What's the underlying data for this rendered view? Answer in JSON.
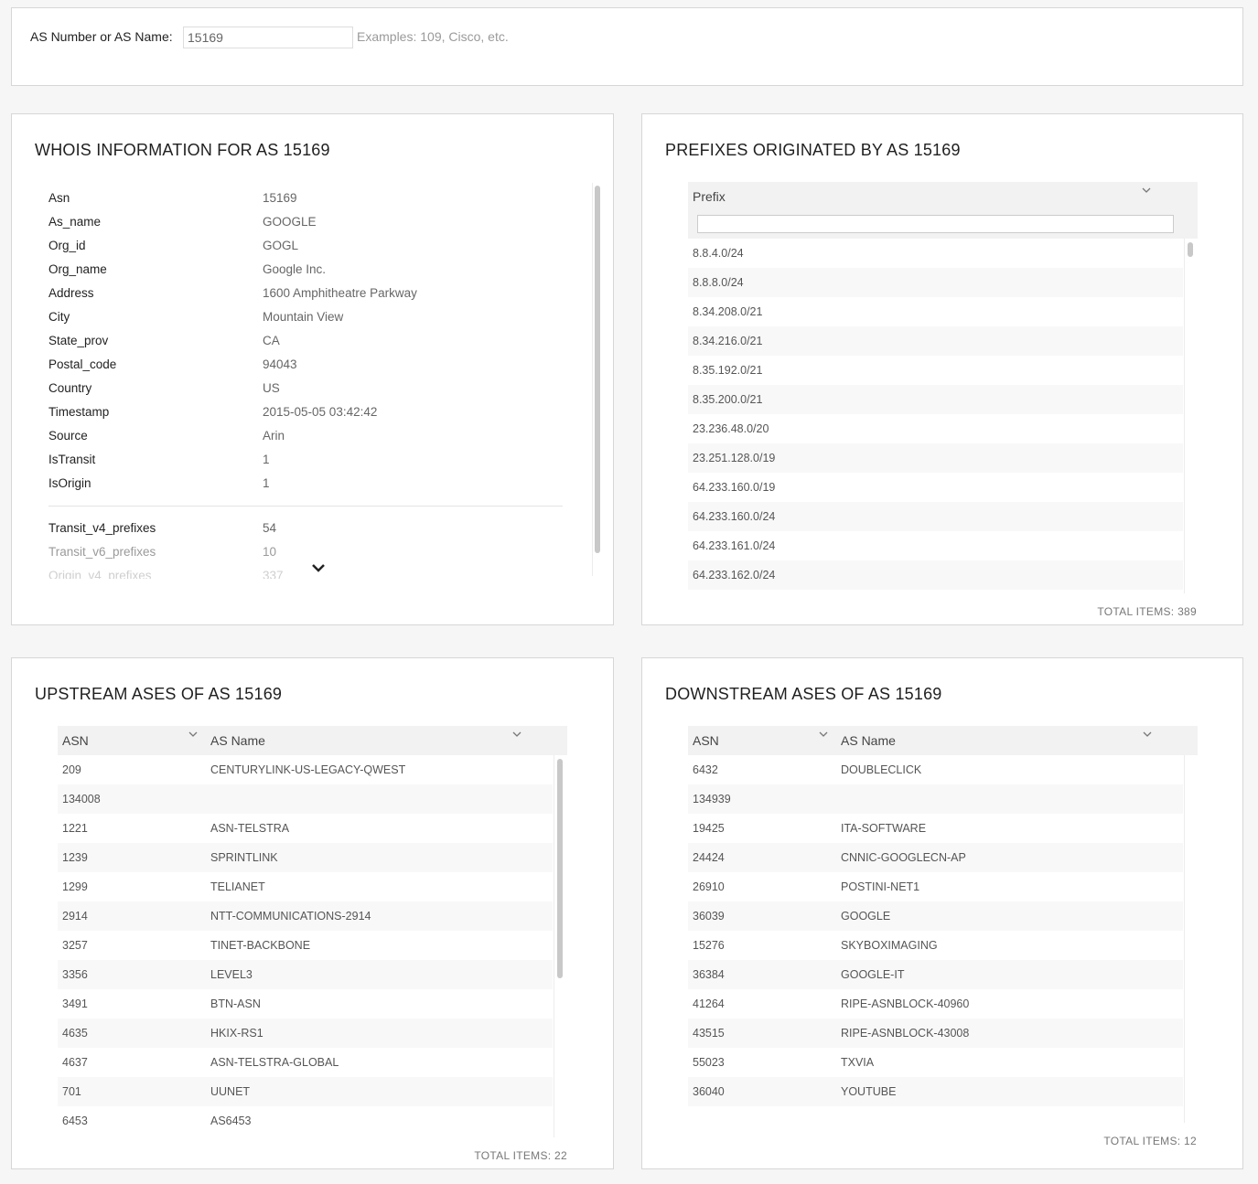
{
  "search": {
    "label": "AS Number or AS Name:",
    "value": "15169",
    "hint": "Examples: 109, Cisco, etc."
  },
  "whois": {
    "title": "WHOIS INFORMATION FOR AS 15169",
    "rows": [
      {
        "key": "Asn",
        "value": "15169"
      },
      {
        "key": "As_name",
        "value": "GOOGLE"
      },
      {
        "key": "Org_id",
        "value": "GOGL"
      },
      {
        "key": "Org_name",
        "value": "Google Inc."
      },
      {
        "key": "Address",
        "value": "1600 Amphitheatre Parkway"
      },
      {
        "key": "City",
        "value": "Mountain View"
      },
      {
        "key": "State_prov",
        "value": "CA"
      },
      {
        "key": "Postal_code",
        "value": "94043"
      },
      {
        "key": "Country",
        "value": "US"
      },
      {
        "key": "Timestamp",
        "value": "2015-05-05 03:42:42"
      },
      {
        "key": "Source",
        "value": "Arin"
      },
      {
        "key": "IsTransit",
        "value": "1"
      },
      {
        "key": "IsOrigin",
        "value": "1"
      }
    ],
    "stats": [
      {
        "key": "Transit_v4_prefixes",
        "value": "54"
      },
      {
        "key": "Transit_v6_prefixes",
        "value": "10"
      },
      {
        "key": "Origin_v4_prefixes",
        "value": "337"
      }
    ],
    "more_icon": "chevron-down-icon"
  },
  "prefixes": {
    "title": "PREFIXES ORIGINATED BY AS 15169",
    "column": "Prefix",
    "filter_value": "",
    "rows": [
      "8.8.4.0/24",
      "8.8.8.0/24",
      "8.34.208.0/21",
      "8.34.216.0/21",
      "8.35.192.0/21",
      "8.35.200.0/21",
      "23.236.48.0/20",
      "23.251.128.0/19",
      "64.233.160.0/19",
      "64.233.160.0/24",
      "64.233.161.0/24",
      "64.233.162.0/24"
    ],
    "total": "TOTAL ITEMS: 389"
  },
  "upstream": {
    "title": "UPSTREAM ASES OF AS 15169",
    "columns": [
      "ASN",
      "AS Name"
    ],
    "rows": [
      {
        "asn": "209",
        "name": "CENTURYLINK-US-LEGACY-QWEST"
      },
      {
        "asn": "134008",
        "name": ""
      },
      {
        "asn": "1221",
        "name": "ASN-TELSTRA"
      },
      {
        "asn": "1239",
        "name": "SPRINTLINK"
      },
      {
        "asn": "1299",
        "name": "TELIANET"
      },
      {
        "asn": "2914",
        "name": "NTT-COMMUNICATIONS-2914"
      },
      {
        "asn": "3257",
        "name": "TINET-BACKBONE"
      },
      {
        "asn": "3356",
        "name": "LEVEL3"
      },
      {
        "asn": "3491",
        "name": "BTN-ASN"
      },
      {
        "asn": "4635",
        "name": "HKIX-RS1"
      },
      {
        "asn": "4637",
        "name": "ASN-TELSTRA-GLOBAL"
      },
      {
        "asn": "701",
        "name": "UUNET"
      },
      {
        "asn": "6453",
        "name": "AS6453"
      }
    ],
    "total": "TOTAL ITEMS: 22"
  },
  "downstream": {
    "title": "DOWNSTREAM ASES OF AS 15169",
    "columns": [
      "ASN",
      "AS Name"
    ],
    "rows": [
      {
        "asn": "6432",
        "name": "DOUBLECLICK"
      },
      {
        "asn": "134939",
        "name": ""
      },
      {
        "asn": "19425",
        "name": "ITA-SOFTWARE"
      },
      {
        "asn": "24424",
        "name": "CNNIC-GOOGLECN-AP"
      },
      {
        "asn": "26910",
        "name": "POSTINI-NET1"
      },
      {
        "asn": "36039",
        "name": "GOOGLE"
      },
      {
        "asn": "15276",
        "name": "SKYBOXIMAGING"
      },
      {
        "asn": "36384",
        "name": "GOOGLE-IT"
      },
      {
        "asn": "41264",
        "name": "RIPE-ASNBLOCK-40960"
      },
      {
        "asn": "43515",
        "name": "RIPE-ASNBLOCK-43008"
      },
      {
        "asn": "55023",
        "name": "TXVIA"
      },
      {
        "asn": "36040",
        "name": "YOUTUBE"
      }
    ],
    "total": "TOTAL ITEMS: 12"
  },
  "icons": {
    "sort": "chevron-down-icon"
  }
}
